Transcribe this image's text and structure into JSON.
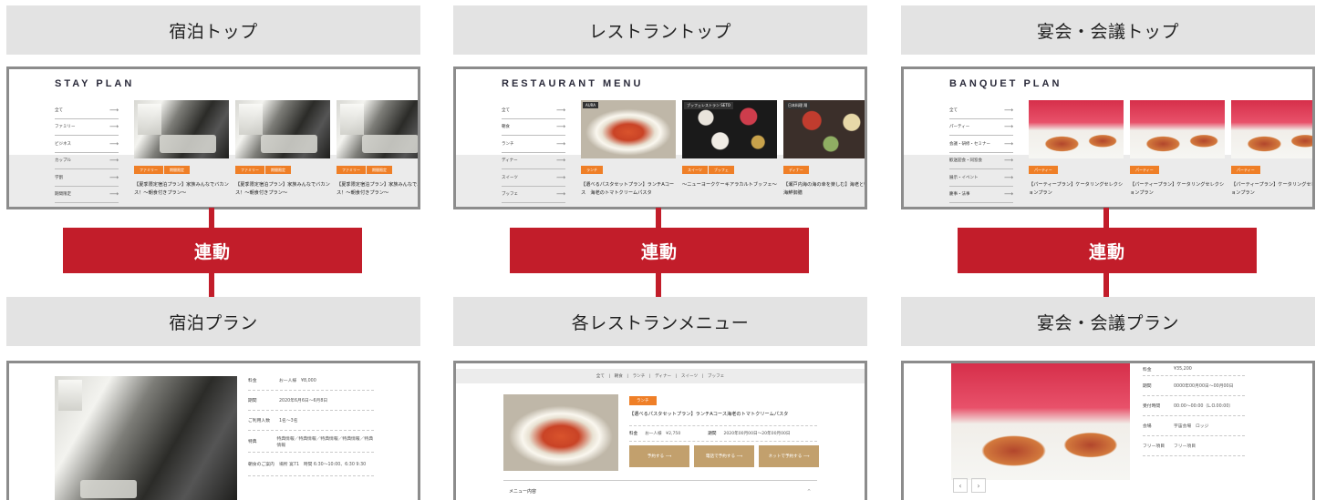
{
  "columns": [
    {
      "top_header": "宿泊トップ",
      "link_label": "連動",
      "bottom_header": "宿泊プラン",
      "top_frame": {
        "section_title": "STAY PLAN",
        "categories": [
          "全て",
          "ファミリー",
          "ビジネス",
          "カップル",
          "学割",
          "期間限定"
        ],
        "cards": [
          {
            "badges": [
              "ファミリー",
              "期間限定"
            ],
            "text": "【夏季限定宿泊プラン】家族みんなでバカンス！〜朝食付きプラン〜",
            "image": "hotel-room"
          },
          {
            "badges": [
              "ファミリー",
              "期間限定"
            ],
            "text": "【夏季限定宿泊プラン】家族みんなでバカンス！〜朝食付きプラン〜",
            "image": "hotel-room"
          },
          {
            "badges": [
              "ファミリー",
              "期間限定"
            ],
            "text": "【夏季限定宿泊プラン】家族みんなでバカンス！〜朝食付きプラン〜",
            "image": "hotel-room"
          }
        ]
      },
      "bottom_frame": {
        "info": [
          {
            "label": "料金",
            "value": "お一人様　¥8,000"
          },
          {
            "label": "期間",
            "value": "2020年6月6日〜6月8日"
          },
          {
            "label": "ご利用人数",
            "value": "1名〜3名"
          },
          {
            "label": "特典",
            "value": "特典情報／特典情報／特典情報／特典情報／特典情報"
          },
          {
            "label": "朝食のご案内",
            "value": "場所 宴71　時間 6:30〜10:00、6:30 9:30"
          }
        ]
      }
    },
    {
      "top_header": "レストラントップ",
      "link_label": "連動",
      "bottom_header": "各レストランメニュー",
      "top_frame": {
        "section_title": "RESTAURANT MENU",
        "categories": [
          "全て",
          "朝食",
          "ランチ",
          "ディナー",
          "スイーツ",
          "ブッフェ"
        ],
        "cards": [
          {
            "tag": "AURA",
            "badges": [
              "ランチ"
            ],
            "text": "【選べるパスタセットプラン】ランチAコース　海老のトマトクリームパスタ",
            "image": "shrimp-pasta"
          },
          {
            "tag": "ブッフェレストラン SETO",
            "badges": [
              "スイーツ",
              "ブッフェ"
            ],
            "text": "〜ニューヨークケーキアラカルトブッフェ〜",
            "image": "buffet"
          },
          {
            "tag": "日本料理 翔",
            "badges": [
              "ディナー"
            ],
            "text": "【瀬戸内海の海の幸を楽しむ】海老と牡蠣の海鮮御膳",
            "image": "japanese-set"
          }
        ]
      },
      "bottom_frame": {
        "nav": "全て　|　朝食　|　ランチ　|　ディナー　|　スイーツ　|　ブッフェ",
        "badge": "ランチ",
        "title": "【選べるパスタセットプラン】ランチAコース海老のトマトクリームパスタ",
        "price_label": "料金",
        "price_value": "お一人様　¥2,750",
        "period_label": "期間",
        "period_value": "2020年00月00日〜20年00月00日",
        "buttons": [
          "予約する",
          "電話で予約する",
          "ネットで予約する"
        ],
        "menu_label": "メニュー内容"
      }
    },
    {
      "top_header": "宴会・会議トップ",
      "link_label": "連動",
      "bottom_header": "宴会・会議プラン",
      "top_frame": {
        "section_title": "BANQUET PLAN",
        "categories": [
          "全て",
          "パーティー",
          "会議・研修・セミナー",
          "歓送迎会・同窓会",
          "展示・イベント",
          "慶事・法事"
        ],
        "cards": [
          {
            "badges": [
              "パーティー"
            ],
            "text": "【パーティープラン】ケータリングセレクションプラン",
            "image": "party"
          },
          {
            "badges": [
              "パーティー"
            ],
            "text": "【パーティープラン】ケータリングセレクションプラン",
            "image": "party"
          },
          {
            "badges": [
              "パーティー"
            ],
            "text": "【パーティープラン】ケータリングセレクションプラン",
            "image": "party"
          }
        ]
      },
      "bottom_frame": {
        "info": [
          {
            "label": "料金",
            "value": "¥35,200"
          },
          {
            "label": "期間",
            "value": "0000年00月00日〜00月00日"
          },
          {
            "label": "受付時間",
            "value": "00:00〜00:00（L.O.00:00）"
          },
          {
            "label": "会場",
            "value": "宇宙会場　ロッジ"
          },
          {
            "label": "フリー項目",
            "value": "フリー項目"
          }
        ],
        "pager_prev": "‹",
        "pager_next": "›"
      }
    }
  ]
}
